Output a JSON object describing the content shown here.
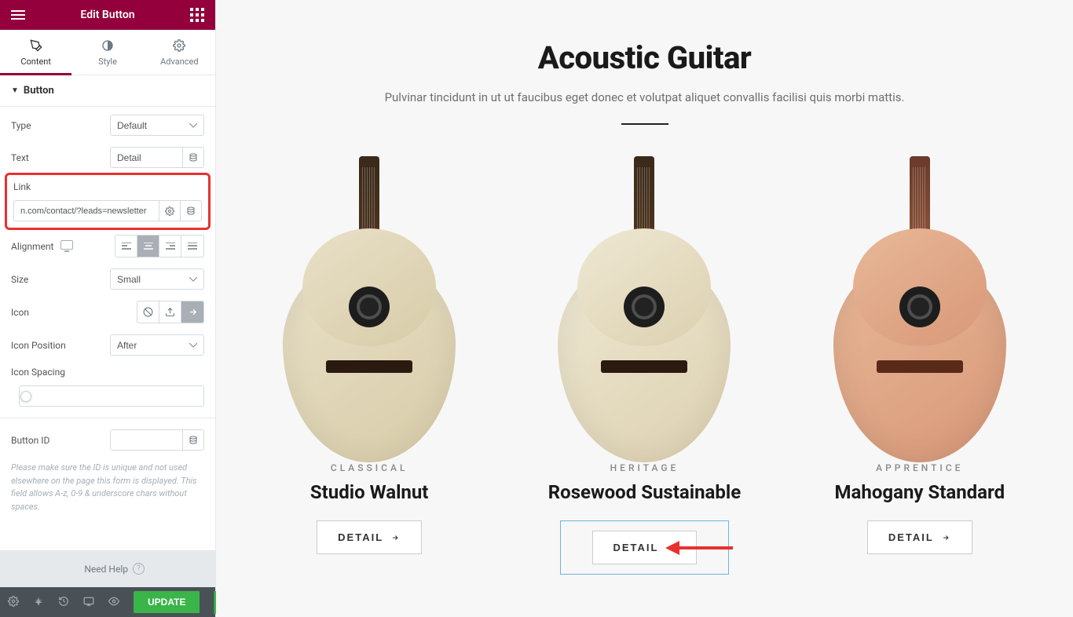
{
  "header": {
    "title": "Edit Button"
  },
  "tabs": {
    "content": "Content",
    "style": "Style",
    "advanced": "Advanced"
  },
  "section": {
    "name": "Button"
  },
  "fields": {
    "type": {
      "label": "Type",
      "value": "Default"
    },
    "text": {
      "label": "Text",
      "value": "Detail"
    },
    "link": {
      "label": "Link",
      "value": "n.com/contact/?leads=newsletter"
    },
    "alignment": {
      "label": "Alignment"
    },
    "size": {
      "label": "Size",
      "value": "Small"
    },
    "icon": {
      "label": "Icon"
    },
    "icon_position": {
      "label": "Icon Position",
      "value": "After"
    },
    "icon_spacing": {
      "label": "Icon Spacing",
      "value": "8"
    },
    "button_id": {
      "label": "Button ID",
      "value": ""
    },
    "note": "Please make sure the ID is unique and not used elsewhere on the page this form is displayed. This field allows A-z,  0-9  & underscore chars without spaces."
  },
  "footer": {
    "help": "Need Help",
    "update": "UPDATE"
  },
  "page": {
    "title": "Acoustic Guitar",
    "subtitle": "Pulvinar tincidunt in ut ut faucibus eget donec et volutpat aliquet convallis facilisi quis morbi mattis."
  },
  "products": [
    {
      "category": "CLASSICAL",
      "name": "Studio Walnut",
      "button": "DETAIL"
    },
    {
      "category": "HERITAGE",
      "name": "Rosewood Sustainable",
      "button": "DETAIL"
    },
    {
      "category": "APPRENTICE",
      "name": "Mahogany Standard",
      "button": "DETAIL"
    }
  ]
}
